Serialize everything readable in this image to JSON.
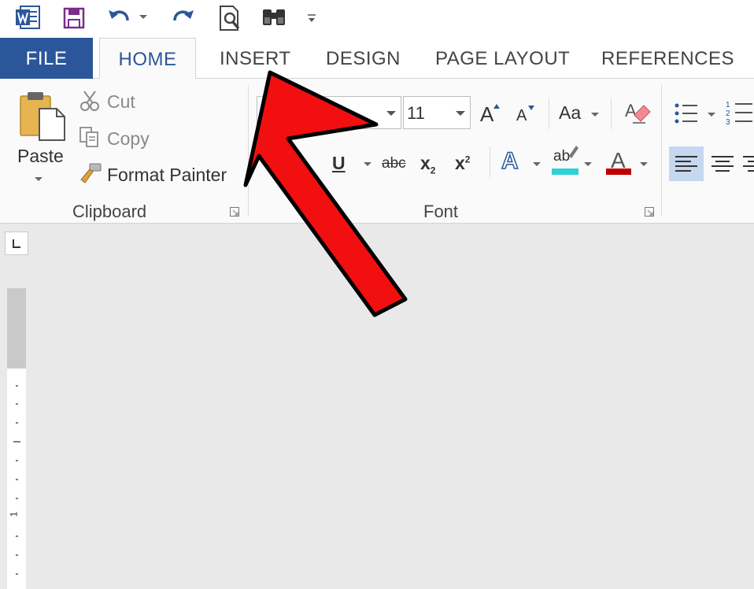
{
  "quick_access": {
    "icons": [
      "word-logo-icon",
      "save-icon",
      "undo-icon",
      "redo-icon",
      "print-preview-icon",
      "find-binoculars-icon",
      "customize-toolbar-icon"
    ]
  },
  "tabs": [
    {
      "id": "file",
      "label": "FILE"
    },
    {
      "id": "home",
      "label": "HOME"
    },
    {
      "id": "insert",
      "label": "INSERT"
    },
    {
      "id": "design",
      "label": "DESIGN"
    },
    {
      "id": "page_layout",
      "label": "PAGE LAYOUT"
    },
    {
      "id": "references",
      "label": "REFERENCES"
    }
  ],
  "clipboard": {
    "paste_label": "Paste",
    "cut_label": "Cut",
    "copy_label": "Copy",
    "format_painter_label": "Format Painter",
    "group_label": "Clipboard"
  },
  "font": {
    "font_name": "",
    "font_size": "11",
    "grow_font": "A",
    "shrink_font": "A",
    "change_case": "Aa",
    "underline": "U",
    "strikethrough": "abc",
    "subscript": "x",
    "subscript_small": "2",
    "superscript": "x",
    "superscript_small": "2",
    "text_effects": "A",
    "highlight": "ab",
    "font_color": "A",
    "group_label": "Font"
  },
  "vertical_ruler": {
    "label": "1"
  },
  "colors": {
    "accent": "#2b579a",
    "highlight": "#2ed1d6",
    "font_color": "#c00000",
    "arrow": "#ff0000"
  }
}
